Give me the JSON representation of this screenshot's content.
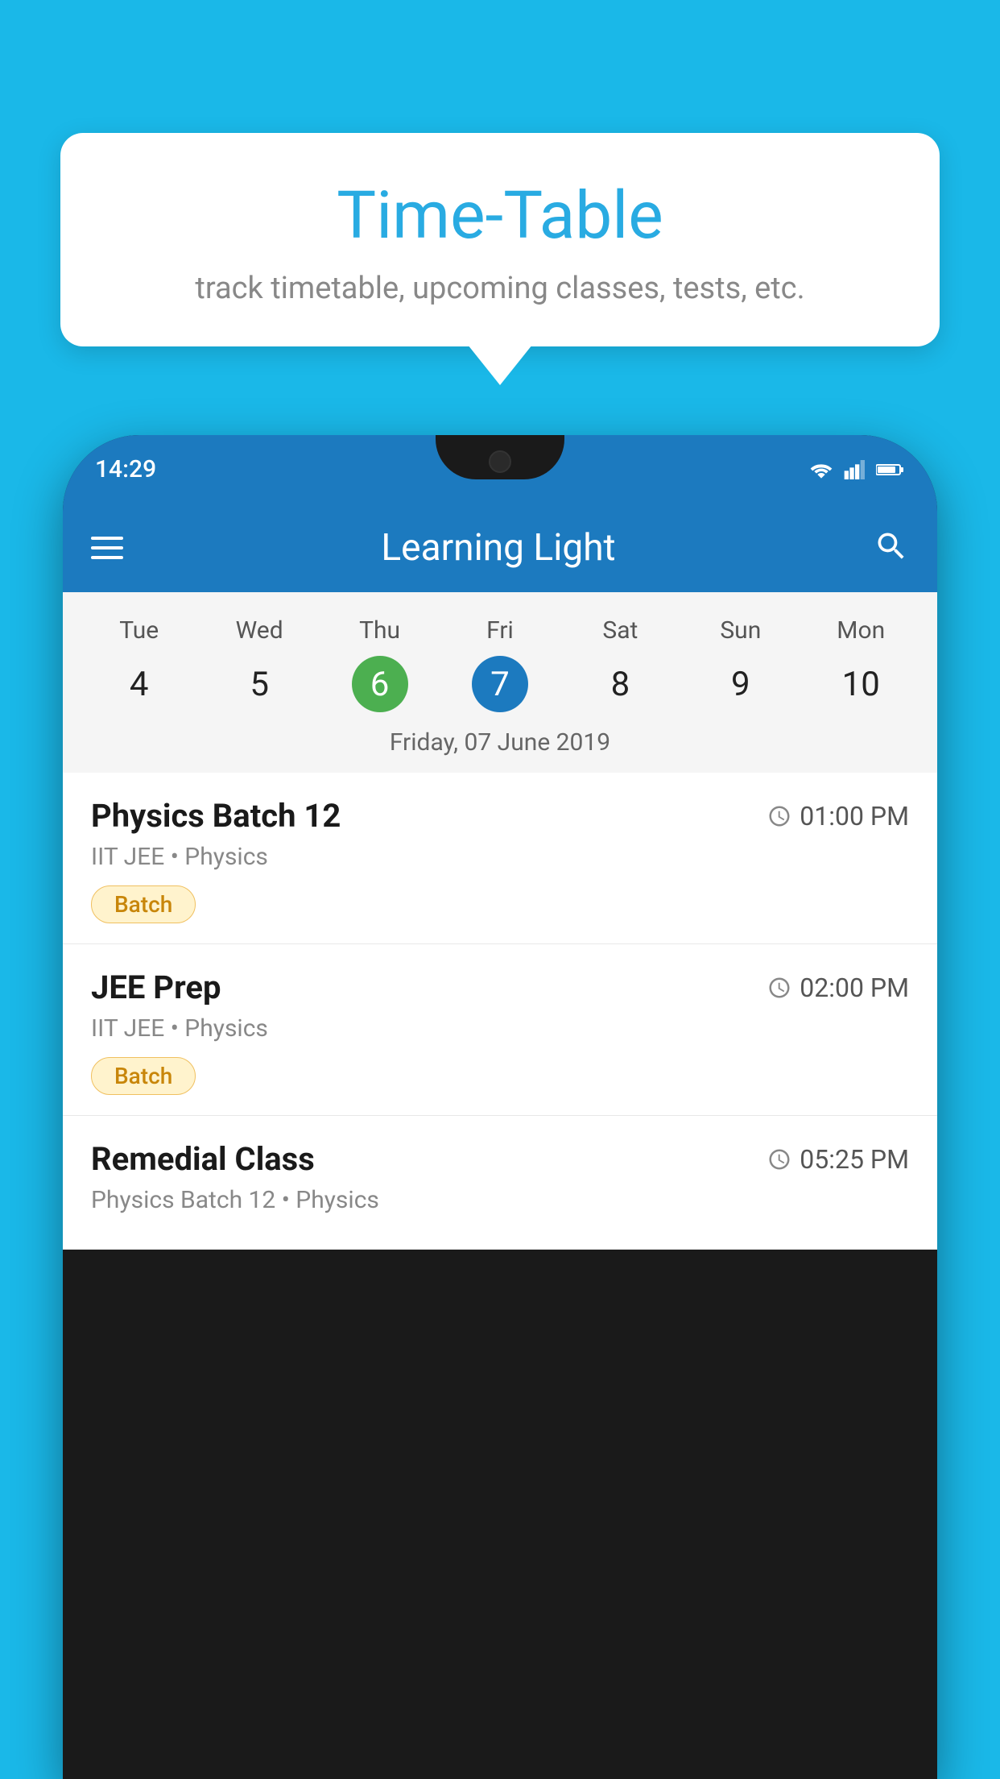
{
  "background_color": "#1ab8e8",
  "bubble": {
    "title": "Time-Table",
    "subtitle": "track timetable, upcoming classes, tests, etc."
  },
  "phone": {
    "status_bar": {
      "time": "14:29"
    },
    "toolbar": {
      "title": "Learning Light"
    },
    "calendar": {
      "days": [
        {
          "name": "Tue",
          "num": "4",
          "state": "normal"
        },
        {
          "name": "Wed",
          "num": "5",
          "state": "normal"
        },
        {
          "name": "Thu",
          "num": "6",
          "state": "today"
        },
        {
          "name": "Fri",
          "num": "7",
          "state": "selected"
        },
        {
          "name": "Sat",
          "num": "8",
          "state": "normal"
        },
        {
          "name": "Sun",
          "num": "9",
          "state": "normal"
        },
        {
          "name": "Mon",
          "num": "10",
          "state": "normal"
        }
      ],
      "selected_date_label": "Friday, 07 June 2019"
    },
    "schedule": [
      {
        "title": "Physics Batch 12",
        "time": "01:00 PM",
        "subtitle": "IIT JEE • Physics",
        "badge": "Batch"
      },
      {
        "title": "JEE Prep",
        "time": "02:00 PM",
        "subtitle": "IIT JEE • Physics",
        "badge": "Batch"
      },
      {
        "title": "Remedial Class",
        "time": "05:25 PM",
        "subtitle": "Physics Batch 12 • Physics",
        "badge": null
      }
    ]
  }
}
